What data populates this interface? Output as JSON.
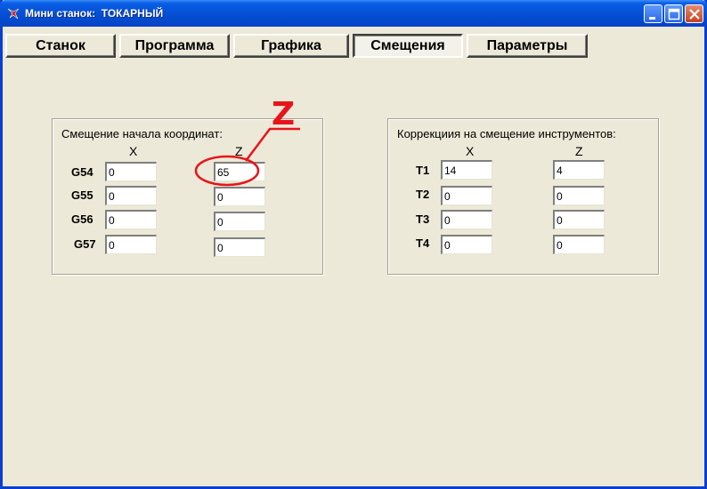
{
  "window": {
    "title": "Мини станок:  ТОКАРНЫЙ"
  },
  "tabs": [
    {
      "label": "Станок"
    },
    {
      "label": "Программа"
    },
    {
      "label": "Графика"
    },
    {
      "label": "Смещения",
      "active": true
    },
    {
      "label": "Параметры"
    }
  ],
  "offsets": {
    "title": "Смещение начала координат:",
    "col_x": "X",
    "col_z": "Z",
    "rows": [
      {
        "label": "G54",
        "x": "0",
        "z": "65"
      },
      {
        "label": "G55",
        "x": "0",
        "z": "0"
      },
      {
        "label": "G56",
        "x": "0",
        "z": "0"
      },
      {
        "label": "G57",
        "x": "0",
        "z": "0"
      }
    ]
  },
  "tools": {
    "title": "Коррекциия на смещение инструментов:",
    "col_x": "X",
    "col_z": "Z",
    "rows": [
      {
        "label": "T1",
        "x": "14",
        "z": "4"
      },
      {
        "label": "T2",
        "x": "0",
        "z": "0"
      },
      {
        "label": "T3",
        "x": "0",
        "z": "0"
      },
      {
        "label": "T4",
        "x": "0",
        "z": "0"
      }
    ]
  },
  "annotation": {
    "letter": "Z",
    "color": "#e8141b"
  },
  "icons": {
    "app": "app-logo-icon",
    "minimize": "minimize-icon",
    "maximize": "maximize-icon",
    "close": "close-icon"
  }
}
